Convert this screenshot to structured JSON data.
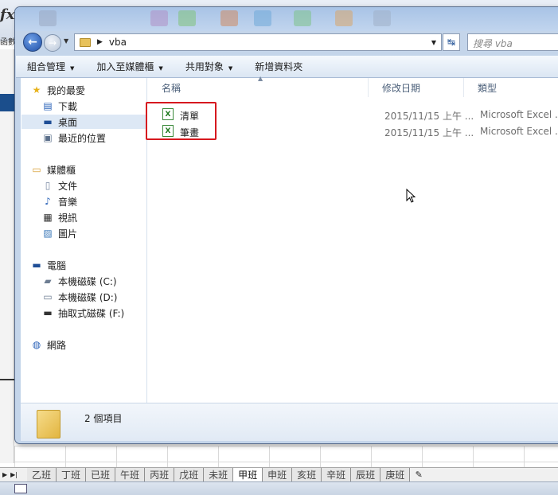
{
  "excel": {
    "fx_label": "fx",
    "func_label": "函數",
    "sheet_tabs": [
      "乙班",
      "丁班",
      "已班",
      "午班",
      "丙班",
      "戊班",
      "未班",
      "甲班",
      "申班",
      "亥班",
      "辛班",
      "辰班",
      "庚班"
    ],
    "active_tab": "甲班"
  },
  "window": {
    "address": {
      "crumb": "vba"
    },
    "search": {
      "placeholder": "搜尋 vba"
    },
    "toolbar": {
      "organize": "組合管理",
      "add_to_library": "加入至媒體櫃",
      "share_with": "共用對象",
      "new_folder": "新增資料夾"
    },
    "nav": {
      "favorites": "我的最愛",
      "downloads": "下載",
      "desktop": "桌面",
      "recent": "最近的位置",
      "libraries": "媒體櫃",
      "documents": "文件",
      "music": "音樂",
      "videos": "視訊",
      "pictures": "圖片",
      "computer": "電腦",
      "drive_c": "本機磁碟 (C:)",
      "drive_d": "本機磁碟 (D:)",
      "drive_f": "抽取式磁碟 (F:)",
      "network": "網路"
    },
    "columns": {
      "name": "名稱",
      "modified": "修改日期",
      "type": "類型"
    },
    "files": [
      {
        "name": "清單",
        "modified": "2015/11/15 上午 ...",
        "type": "Microsoft Excel ..."
      },
      {
        "name": "筆畫",
        "modified": "2015/11/15 上午 ...",
        "type": "Microsoft Excel ..."
      }
    ],
    "details": {
      "count": "2 個項目"
    }
  },
  "colors": {
    "highlight_box": "#d6181f",
    "window_frame": "#c4d5ea"
  }
}
